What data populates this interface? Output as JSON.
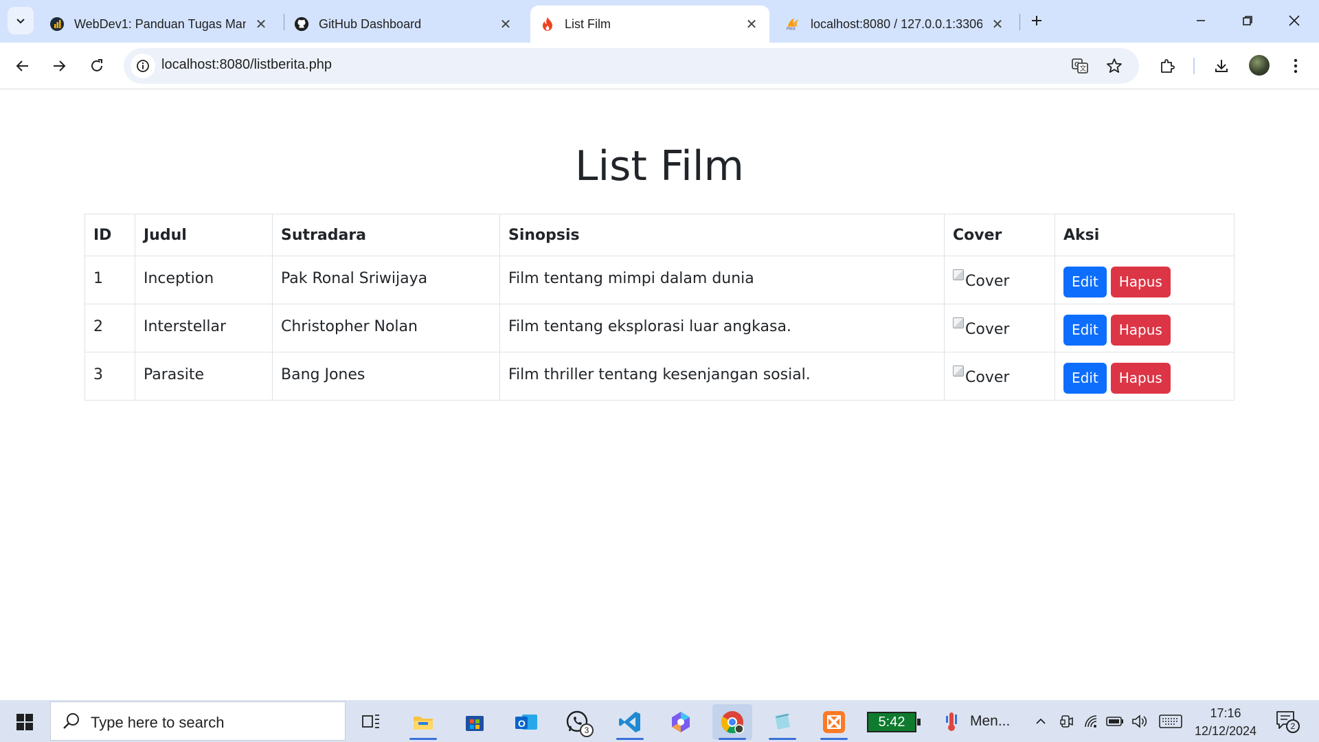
{
  "browser": {
    "tabs": [
      {
        "title": "WebDev1: Panduan Tugas Man",
        "icon": "webdev-favicon"
      },
      {
        "title": "GitHub Dashboard",
        "icon": "github-icon"
      },
      {
        "title": "List Film",
        "icon": "codeigniter-flame-icon"
      },
      {
        "title": "localhost:8080 / 127.0.0.1:3306",
        "icon": "phpmyadmin-icon"
      }
    ],
    "url": "localhost:8080/listberita.php"
  },
  "page": {
    "title": "List Film",
    "table": {
      "headers": [
        "ID",
        "Judul",
        "Sutradara",
        "Sinopsis",
        "Cover",
        "Aksi"
      ],
      "rows": [
        {
          "id": "1",
          "judul": "Inception",
          "sutradara": "Pak Ronal Sriwijaya",
          "sinopsis": "Film tentang mimpi dalam dunia",
          "cover_alt": "Cover"
        },
        {
          "id": "2",
          "judul": "Interstellar",
          "sutradara": "Christopher Nolan",
          "sinopsis": "Film tentang eksplorasi luar angkasa.",
          "cover_alt": "Cover"
        },
        {
          "id": "3",
          "judul": "Parasite",
          "sutradara": "Bang Jones",
          "sinopsis": "Film thriller tentang kesenjangan sosial.",
          "cover_alt": "Cover"
        }
      ],
      "edit_label": "Edit",
      "delete_label": "Hapus"
    },
    "colors": {
      "edit": "#0d6efd",
      "delete": "#dc3545",
      "text": "#212529"
    }
  },
  "taskbar": {
    "search_placeholder": "Type here to search",
    "whatsapp_badge": "3",
    "timer": "5:42",
    "menu_app_label": "Men...",
    "time": "17:16",
    "date": "12/12/2024",
    "notification_count": "2"
  }
}
